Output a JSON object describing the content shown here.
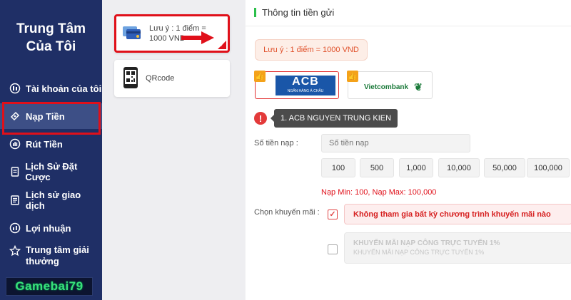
{
  "sidebar": {
    "title_line1": "Trung Tâm",
    "title_line2": "Của Tôi",
    "items": [
      {
        "label": "Tài khoản của tôi",
        "icon": "account-icon"
      },
      {
        "label": "Nạp Tiền",
        "icon": "deposit-icon"
      },
      {
        "label": "Rút Tiền",
        "icon": "withdraw-icon"
      },
      {
        "label": "Lịch Sử Đặt Cược",
        "icon": "bet-history-icon"
      },
      {
        "label": "Lịch sử giao dịch",
        "icon": "transaction-history-icon"
      },
      {
        "label": "Lợi nhuận",
        "icon": "profit-icon"
      },
      {
        "label_line1": "Trung tâm giải",
        "label_line2": "thưởng",
        "icon": "reward-icon"
      }
    ],
    "logo_text": "Gamebai79"
  },
  "methods": [
    {
      "line1": "Lưu ý : 1 điểm =",
      "line2": "1000 VND",
      "icon": "card-icon"
    },
    {
      "label": "QRcode",
      "icon": "qrcode-icon"
    }
  ],
  "main": {
    "section_title": "Thông tin tiền gửi",
    "note": "Lưu ý : 1 điểm = 1000 VND",
    "banks": [
      {
        "name": "ACB",
        "subtitle": "NGÂN HÀNG Á CHÂU"
      },
      {
        "name": "Vietcombank"
      }
    ],
    "warning_icon": "!",
    "tooltip": "1. ACB NGUYEN TRUNG KIEN",
    "amount_label": "Số tiền nạp :",
    "amount_placeholder": "Số tiền nạp",
    "quick_amounts": [
      "100",
      "500",
      "1,000",
      "10,000",
      "50,000",
      "100,000"
    ],
    "limits": "Nạp Min:  100,  Nạp Max:  100,000",
    "promo_label": "Chọn khuyến mãi :",
    "promo_options": [
      {
        "title": "Không tham gia bất kỳ chương trình khuyến mãi nào",
        "checked": true
      },
      {
        "title": "KHUYẾN MÃI NẠP CÔNG TRỰC TUYẾN 1%",
        "subtitle": "KHUYẾN MÃI NẠP CÔNG TRỰC TUYẾN 1%",
        "checked": false
      }
    ]
  },
  "colors": {
    "sidebar_bg": "#1f2f66",
    "highlight_red": "#e0101a",
    "accent_green": "#2bbf4a",
    "note_orange": "#e0502a"
  }
}
